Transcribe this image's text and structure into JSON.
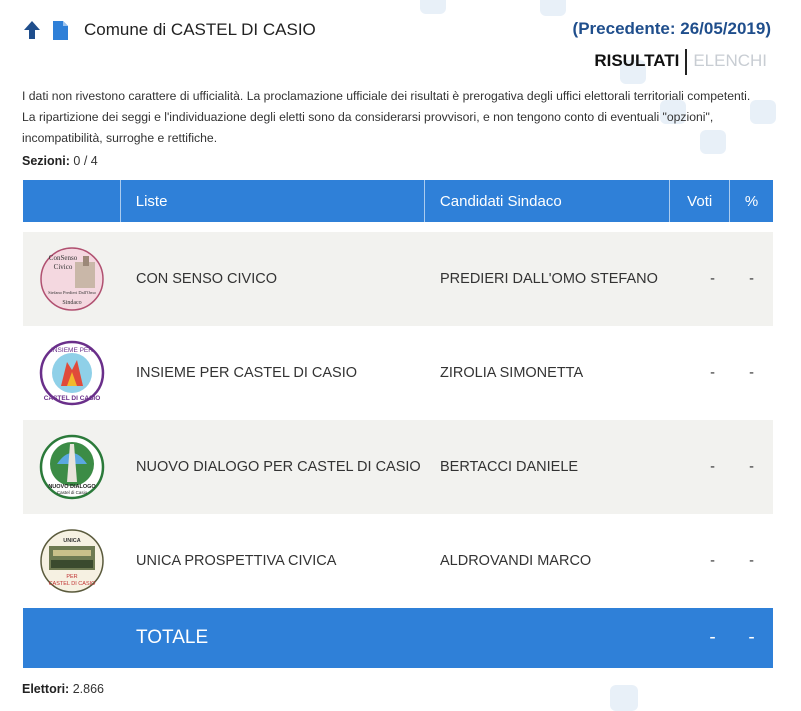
{
  "header": {
    "back_icon": "arrow-up-icon",
    "doc_icon": "document-icon",
    "comune_title": "Comune di CASTEL DI CASIO",
    "precedente": "(Precedente: 26/05/2019)"
  },
  "tabs": [
    {
      "label": "RISULTATI",
      "active": true
    },
    {
      "label": "ELENCHI",
      "active": false
    }
  ],
  "disclaimer": "I dati non rivestono carattere di ufficialità. La proclamazione ufficiale dei risultati è prerogativa degli uffici elettorali territoriali competenti. La ripartizione dei seggi e l'individuazione degli eletti sono da considerarsi provvisori, e non tengono conto di eventuali \"opzioni\", incompatibilità, surroghe e rettifiche.",
  "sezioni": {
    "label": "Sezioni:",
    "value": "0 / 4"
  },
  "table": {
    "columns": [
      "Liste",
      "Candidati Sindaco",
      "Voti",
      "%"
    ],
    "rows": [
      {
        "lista": "CON SENSO CIVICO",
        "candidato": "PREDIERI DALL'OMO STEFANO",
        "voti": "-",
        "pct": "-",
        "logo_text": [
          "ConSenso",
          "Civico",
          "Stefano Predieri Dall'Omo",
          "Sindaco"
        ]
      },
      {
        "lista": "INSIEME PER CASTEL DI CASIO",
        "candidato": "ZIROLIA SIMONETTA",
        "voti": "-",
        "pct": "-",
        "logo_text": [
          "INSIEME PER",
          "CASTEL DI CASIO"
        ]
      },
      {
        "lista": "NUOVO DIALOGO PER CASTEL DI CASIO",
        "candidato": "BERTACCI DANIELE",
        "voti": "-",
        "pct": "-",
        "logo_text": [
          "NUOVO DIALOGO",
          "Castel di Casio"
        ]
      },
      {
        "lista": "UNICA PROSPETTIVA CIVICA",
        "candidato": "ALDROVANDI MARCO",
        "voti": "-",
        "pct": "-",
        "logo_text": [
          "UNICA",
          "PER",
          "CASTEL DI CASIO"
        ]
      }
    ],
    "totale": {
      "label": "TOTALE",
      "voti": "-",
      "pct": "-"
    }
  },
  "elettori": {
    "label": "Elettori:",
    "value": "2.866"
  },
  "colors": {
    "header_blue": "#2f80d8",
    "title_blue": "#1f4e8c",
    "row_alt": "#f2f2ef"
  }
}
